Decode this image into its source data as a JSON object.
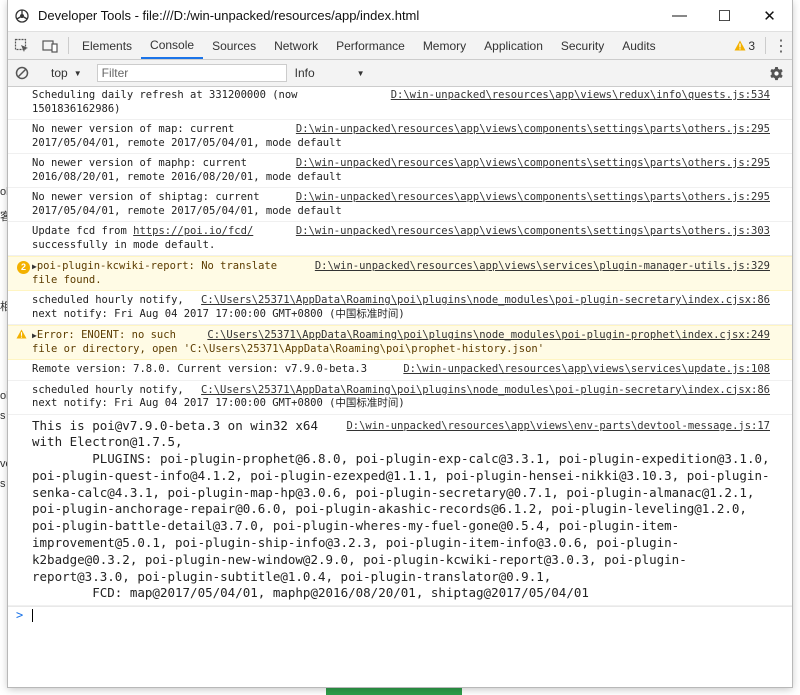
{
  "window": {
    "title": "Developer Tools - file:///D:/win-unpacked/resources/app/index.html",
    "controls": {
      "minimize": "—",
      "maximize": "☐",
      "close": "✕"
    }
  },
  "background_fragments": [
    "ob",
    "客",
    "相",
    "ole",
    "s",
    "ve",
    "s"
  ],
  "tabs": [
    {
      "label": "Elements",
      "active": false
    },
    {
      "label": "Console",
      "active": true
    },
    {
      "label": "Sources",
      "active": false
    },
    {
      "label": "Network",
      "active": false
    },
    {
      "label": "Performance",
      "active": false
    },
    {
      "label": "Memory",
      "active": false
    },
    {
      "label": "Application",
      "active": false
    },
    {
      "label": "Security",
      "active": false
    },
    {
      "label": "Audits",
      "active": false
    }
  ],
  "warning_count": "3",
  "toolbar": {
    "context": "top",
    "filter_placeholder": "Filter",
    "level": "Info"
  },
  "messages": [
    {
      "source": "D:\\win-unpacked\\resources\\app\\views\\redux\\info\\quests.js:534",
      "text": "Scheduling daily refresh at 331200000 (now 1501836162986)"
    },
    {
      "source": "D:\\win-unpacked\\resources\\app\\views\\components\\settings\\parts\\others.js:295",
      "text": "No newer version of map: current 2017/05/04/01, remote 2017/05/04/01, mode default"
    },
    {
      "source": "D:\\win-unpacked\\resources\\app\\views\\components\\settings\\parts\\others.js:295",
      "text": "No newer version of maphp: current 2016/08/20/01, remote 2016/08/20/01, mode default"
    },
    {
      "source": "D:\\win-unpacked\\resources\\app\\views\\components\\settings\\parts\\others.js:295",
      "text": "No newer version of shiptag: current 2017/05/04/01, remote 2017/05/04/01, mode default"
    },
    {
      "source": "D:\\win-unpacked\\resources\\app\\views\\components\\settings\\parts\\others.js:303",
      "text_before": "Update fcd from ",
      "link": "https://poi.io/fcd/",
      "text_after": " successfully in mode default."
    },
    {
      "source": "D:\\win-unpacked\\resources\\app\\views\\services\\plugin-manager-utils.js:329",
      "text": "poi-plugin-kcwiki-report: No translate file found.",
      "count": "2"
    },
    {
      "source": "C:\\Users\\25371\\AppData\\Roaming\\poi\\plugins\\node_modules\\poi-plugin-secretary\\index.cjsx:86",
      "text": "scheduled hourly notify, next notify: Fri Aug 04 2017 17:00:00 GMT+0800 (中国标准时间)"
    },
    {
      "source": "C:\\Users\\25371\\AppData\\Roaming\\poi\\plugins\\node_modules\\poi-plugin-prophet\\index.cjsx:249",
      "text": "Error: ENOENT: no such file or directory, open 'C:\\Users\\25371\\AppData\\Roaming\\poi\\prophet-history.json'"
    },
    {
      "source": "D:\\win-unpacked\\resources\\app\\views\\services\\update.js:108",
      "text": "Remote version: 7.8.0. Current version: v7.9.0-beta.3"
    },
    {
      "source": "C:\\Users\\25371\\AppData\\Roaming\\poi\\plugins\\node_modules\\poi-plugin-secretary\\index.cjsx:86",
      "text": "scheduled hourly notify, next notify: Fri Aug 04 2017 17:00:00 GMT+0800 (中国标准时间)"
    },
    {
      "source": "D:\\win-unpacked\\resources\\app\\views\\env-parts\\devtool-message.js:17",
      "text": "This is poi@v7.9.0-beta.3 on win32 x64 with Electron@1.7.5,\n        PLUGINS: poi-plugin-prophet@6.8.0, poi-plugin-exp-calc@3.3.1, poi-plugin-expedition@3.1.0, poi-plugin-quest-info@4.1.2, poi-plugin-ezexped@1.1.1, poi-plugin-hensei-nikki@3.10.3, poi-plugin-senka-calc@4.3.1, poi-plugin-map-hp@3.0.6, poi-plugin-secretary@0.7.1, poi-plugin-almanac@1.2.1, poi-plugin-anchorage-repair@0.6.0, poi-plugin-akashic-records@6.1.2, poi-plugin-leveling@1.2.0, poi-plugin-battle-detail@3.7.0, poi-plugin-wheres-my-fuel-gone@0.5.4, poi-plugin-item-improvement@5.0.1, poi-plugin-ship-info@3.2.3, poi-plugin-item-info@3.0.6, poi-plugin-k2badge@0.3.2, poi-plugin-new-window@2.9.0, poi-plugin-kcwiki-report@3.0.3, poi-plugin-report@3.3.0, poi-plugin-subtitle@1.0.4, poi-plugin-translator@0.9.1,\n        FCD: map@2017/05/04/01, maphp@2016/08/20/01, shiptag@2017/05/04/01"
    }
  ],
  "prompt_symbol": ">"
}
